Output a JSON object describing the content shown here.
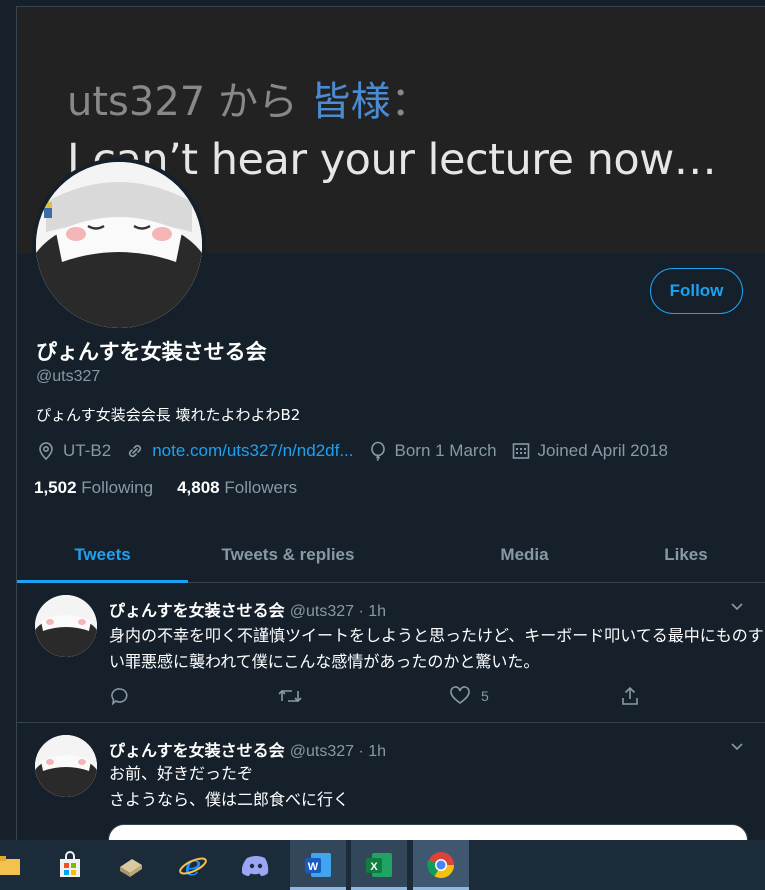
{
  "banner": {
    "line1_prefix": "uts327 から ",
    "line1_highlight": "皆様",
    "line1_suffix": "：",
    "line2": "I can’t hear your lecture now…"
  },
  "profile": {
    "follow_label": "Follow",
    "display_name": "ぴょんすを女装させる会",
    "handle": "@uts327",
    "bio": "ぴょんす女装会会長 壊れたよわよわB2",
    "location": "UT-B2",
    "link": "note.com/uts327/n/nd2df...",
    "birthday": "Born 1 March",
    "joined": "Joined April 2018",
    "following_count": "1,502",
    "following_label": "Following",
    "followers_count": "4,808",
    "followers_label": "Followers"
  },
  "tabs": [
    {
      "label": "Tweets",
      "active": true
    },
    {
      "label": "Tweets & replies",
      "active": false
    },
    {
      "label": "Media",
      "active": false
    },
    {
      "label": "Likes",
      "active": false
    }
  ],
  "tweets": [
    {
      "name": "ぴょんすを女装させる会",
      "handle_time": "@uts327 · 1h",
      "text_line1": "身内の不幸を叩く不謹慎ツイートをしようと思ったけど、キーボード叩いてる最中にものすご",
      "text_line2": "い罪悪感に襲われて僕にこんな感情があったのかと驚いた。",
      "likes": "5"
    },
    {
      "name": "ぴょんすを女装させる会",
      "handle_time": "@uts327 · 1h",
      "text_line1": "お前、好きだったぞ",
      "text_line2": "さようなら、僕は二郎食べに行く"
    }
  ],
  "taskbar": {
    "items": [
      "file-explorer",
      "store",
      "app",
      "internet-explorer",
      "discord",
      "word",
      "excel",
      "chrome"
    ]
  },
  "colors": {
    "background": "#15202b",
    "accent": "#1da1f2",
    "secondary_text": "#8899a6",
    "border": "#38444d"
  }
}
